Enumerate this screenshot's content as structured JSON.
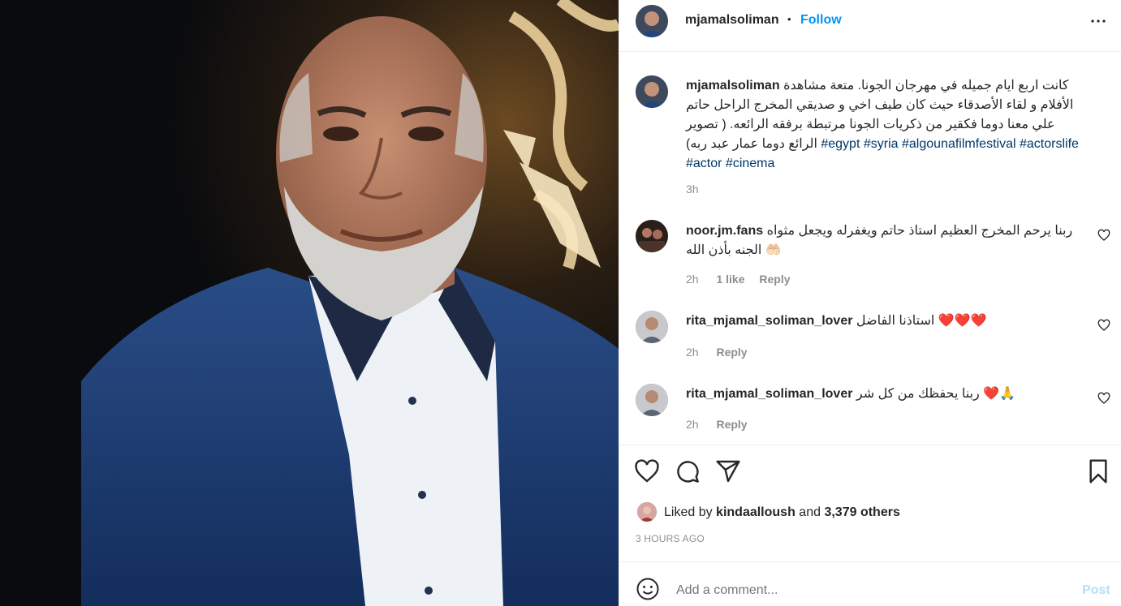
{
  "post": {
    "username": "mjamalsoliman",
    "separator": "•",
    "follow_label": "Follow",
    "more_icon": "more-dots-icon"
  },
  "caption": {
    "username": "mjamalsoliman",
    "text": "كانت اربع ايام جميله في مهرجان الجونا. متعة مشاهدة الأفلام و لقاء الأصدقاء حيث كان طيف اخي و صديقي المخرج الراحل حاتم علي معنا دوما فكقير من ذكريات الجونا مرتبطة برفقه الرائعه. ( تصوير الرائع دوما عمار عبد ربه)",
    "hashtags": [
      "#egypt",
      "#syria",
      "#algounafilmfestival",
      "#actorslife",
      "#actor",
      "#cinema"
    ],
    "time": "3h"
  },
  "comments": [
    {
      "username": "noor.jm.fans",
      "text": "ربنا يرحم المخرج العظيم استاذ حاتم ويغفرله ويجعل مثواه الجنه بأذن الله",
      "emoji": "🤲🏻",
      "time": "2h",
      "likes": "1 like",
      "reply": "Reply"
    },
    {
      "username": "rita_mjamal_soliman_lover",
      "text": "استاذنا الفاضل",
      "emoji": "❤️❤️❤️",
      "time": "2h",
      "reply": "Reply"
    },
    {
      "username": "rita_mjamal_soliman_lover",
      "text": "ربنا يحفظك من كل شر",
      "emoji": "❤️🙏",
      "time": "2h",
      "reply": "Reply"
    }
  ],
  "likes": {
    "prefix": "Liked by",
    "user": "kindaalloush",
    "conj": "and",
    "others": "3,379 others"
  },
  "timestamp": "3 HOURS AGO",
  "add_comment": {
    "placeholder": "Add a comment...",
    "post_label": "Post"
  },
  "colors": {
    "accent": "#0095f6",
    "hashtag": "#00376b",
    "muted": "#8e8e8e",
    "post_disabled": "#b2dffc"
  }
}
